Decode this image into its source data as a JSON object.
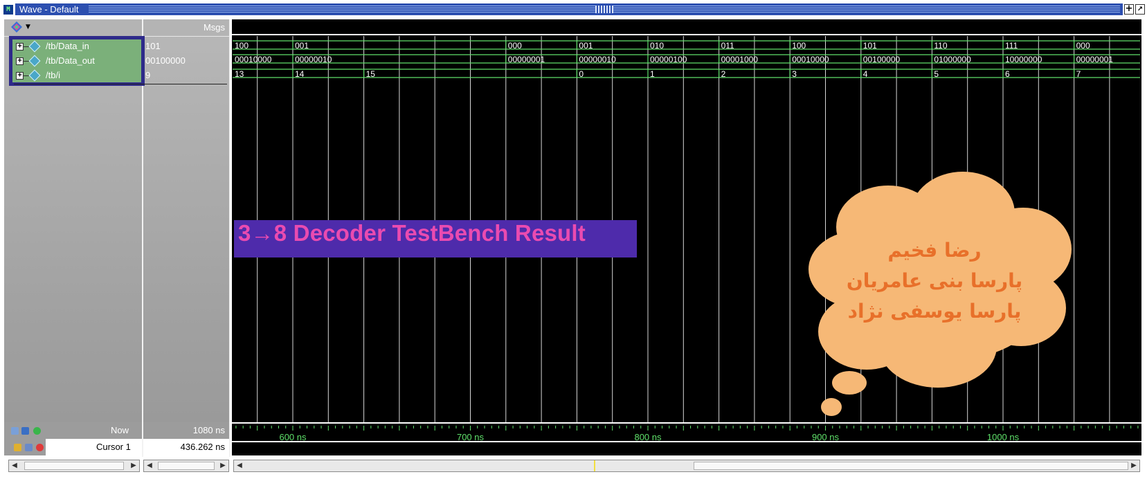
{
  "window": {
    "title": "Wave - Default",
    "app_icon_text": "M"
  },
  "signal_pane": {
    "header_right": "Msgs",
    "signals": [
      {
        "name": "/tb/Data_in",
        "value": "101"
      },
      {
        "name": "/tb/Data_out",
        "value": "00100000"
      },
      {
        "name": "/tb/i",
        "value": "9"
      }
    ]
  },
  "status": {
    "now_label": "Now",
    "now_value": "1080 ns",
    "cursor_label": "Cursor 1",
    "cursor_value": "436.262 ns"
  },
  "waveform": {
    "data_in": [
      {
        "label": "100"
      },
      {
        "label": "001"
      },
      {
        "label": "000"
      },
      {
        "label": "001"
      },
      {
        "label": "010"
      },
      {
        "label": "011"
      },
      {
        "label": "100"
      },
      {
        "label": "101"
      },
      {
        "label": "110"
      },
      {
        "label": "111"
      },
      {
        "label": "000"
      }
    ],
    "data_out": [
      {
        "label": "00010000"
      },
      {
        "label": "00000010"
      },
      {
        "label": "00000001"
      },
      {
        "label": "00000010"
      },
      {
        "label": "00000100"
      },
      {
        "label": "00001000"
      },
      {
        "label": "00010000"
      },
      {
        "label": "00100000"
      },
      {
        "label": "01000000"
      },
      {
        "label": "10000000"
      },
      {
        "label": "00000001"
      }
    ],
    "i": [
      {
        "label": "13"
      },
      {
        "label": "14"
      },
      {
        "label": "15"
      },
      {
        "label": "0"
      },
      {
        "label": "1"
      },
      {
        "label": "2"
      },
      {
        "label": "3"
      },
      {
        "label": "4"
      },
      {
        "label": "5"
      },
      {
        "label": "6"
      },
      {
        "label": "7"
      }
    ],
    "wave_color": "#5fe06a",
    "grid_color": "#d8d8d8",
    "text_color": "#ffffff"
  },
  "timeline": {
    "labels": [
      "600 ns",
      "700 ns",
      "800 ns",
      "900 ns",
      "1000 ns"
    ],
    "color": "#5fe06a"
  },
  "banner": {
    "text": "3→8 Decoder TestBench Result",
    "background": "#4e2bab",
    "text_color": "#ea4bb0"
  },
  "cloud": {
    "lines": [
      "رضا فخیم",
      "پارسا بنی عامریان",
      "پارسا یوسفی نژاد"
    ],
    "fill": "#f6b876",
    "text_color": "#e8702a"
  }
}
